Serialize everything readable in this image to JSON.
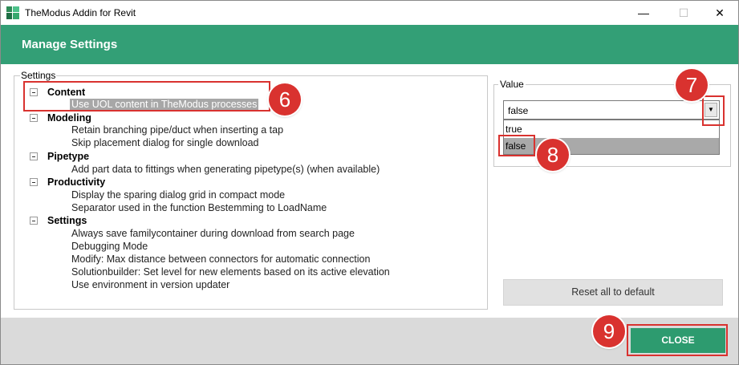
{
  "window": {
    "title": "TheModus Addin for Revit",
    "controls": {
      "minimize": "—",
      "maximize": "☐",
      "close": "✕"
    }
  },
  "header": {
    "title": "Manage Settings"
  },
  "settings": {
    "legend": "Settings",
    "categories": [
      {
        "label": "Content",
        "items": [
          "Use UOL content in TheModus processes"
        ]
      },
      {
        "label": "Modeling",
        "items": [
          "Retain branching pipe/duct when inserting a tap",
          "Skip placement dialog for single download"
        ]
      },
      {
        "label": "Pipetype",
        "items": [
          "Add part data to fittings when generating pipetype(s) (when available)"
        ]
      },
      {
        "label": "Productivity",
        "items": [
          "Display the sparing dialog grid in compact mode",
          "Separator used in the function Bestemming to LoadName"
        ]
      },
      {
        "label": "Settings",
        "items": [
          "Always save familycontainer during download from search page",
          "Debugging Mode",
          "Modify: Max distance between connectors for automatic connection",
          "Solutionbuilder: Set level for new elements based on its active elevation",
          "Use environment in version updater"
        ]
      }
    ]
  },
  "value": {
    "legend": "Value",
    "selected": "false",
    "options": [
      "true",
      "false"
    ],
    "highlighted": "false"
  },
  "buttons": {
    "reset": "Reset all to default",
    "close": "CLOSE"
  },
  "annotations": [
    "6",
    "7",
    "8",
    "9"
  ],
  "colors": {
    "brand_green": "#339f76",
    "annotation_red": "#d9322f",
    "footer_gray": "#dadada"
  }
}
